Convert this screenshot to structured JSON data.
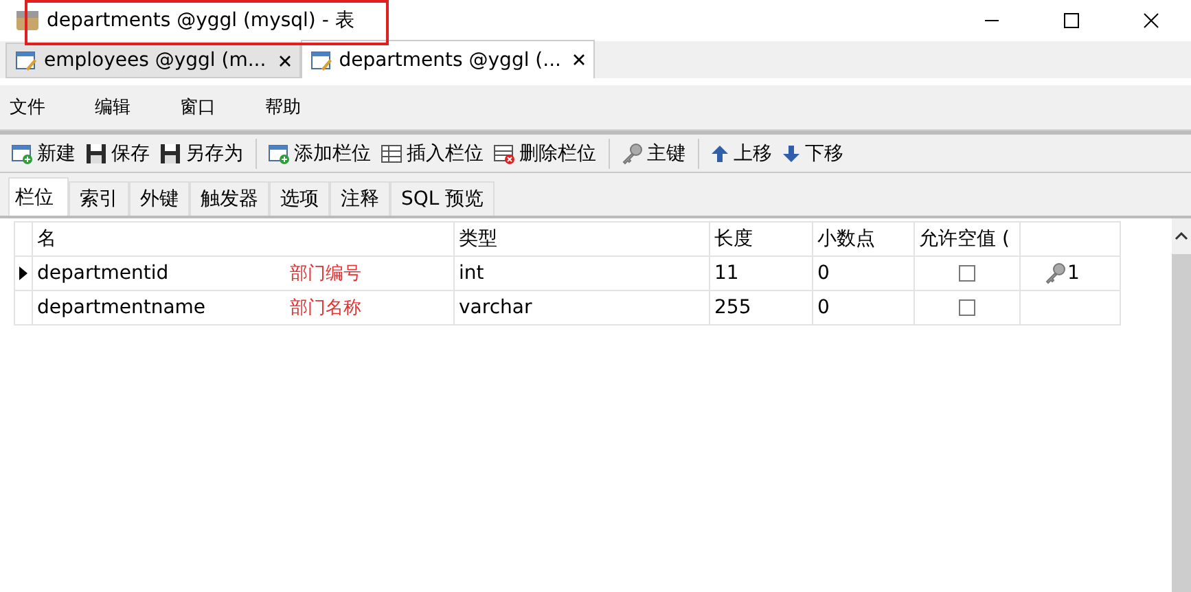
{
  "window": {
    "title": "departments @yggl (mysql) - 表"
  },
  "doc_tabs": [
    {
      "label": "employees @yggl (m...",
      "selected": false
    },
    {
      "label": "departments @yggl (...",
      "selected": true
    }
  ],
  "menu": [
    "文件",
    "编辑",
    "窗口",
    "帮助"
  ],
  "toolbar": [
    "新建",
    "保存",
    "另存为",
    "添加栏位",
    "插入栏位",
    "删除栏位",
    "主键",
    "上移",
    "下移"
  ],
  "tabs": [
    {
      "label": "栏位",
      "selected": true
    },
    {
      "label": "索引",
      "selected": false
    },
    {
      "label": "外键",
      "selected": false
    },
    {
      "label": "触发器",
      "selected": false
    },
    {
      "label": "选项",
      "selected": false
    },
    {
      "label": "注释",
      "selected": false
    },
    {
      "label": "SQL 预览",
      "selected": false
    }
  ],
  "table": {
    "columns": [
      "名",
      "类型",
      "长度",
      "小数点",
      "允许空值 ("
    ],
    "rows": [
      {
        "current": true,
        "name": "departmentid",
        "annotation": "部门编号",
        "type": "int",
        "length": "11",
        "decimals": "0",
        "nullable": false,
        "key": "1"
      },
      {
        "current": false,
        "name": "departmentname",
        "annotation": "部门名称",
        "type": "varchar",
        "length": "255",
        "decimals": "0",
        "nullable": false
      }
    ]
  }
}
